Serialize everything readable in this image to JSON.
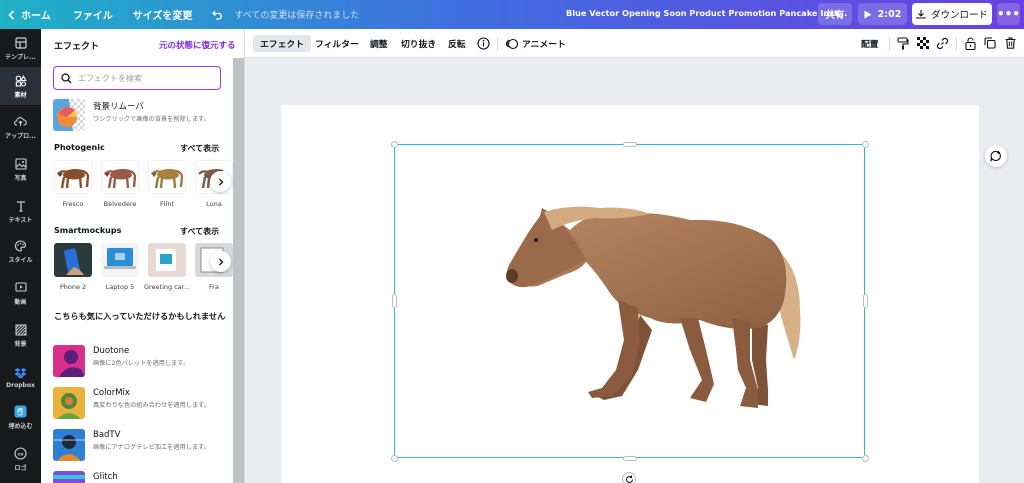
{
  "topbar": {
    "home": "ホーム",
    "file": "ファイル",
    "resize": "サイズを変更",
    "saved": "すべての変更は保存されました",
    "title": "Blue Vector Opening Soon Product Promotion Pancake Inst...",
    "share": "共有",
    "play": "2:02",
    "download": "ダウンロード",
    "more": "•••"
  },
  "rail": [
    {
      "label": "テンプレ...",
      "icon": "template-icon"
    },
    {
      "label": "素材",
      "icon": "elements-icon"
    },
    {
      "label": "アップロ...",
      "icon": "upload-icon"
    },
    {
      "label": "写真",
      "icon": "photo-icon"
    },
    {
      "label": "テキスト",
      "icon": "text-icon"
    },
    {
      "label": "スタイル",
      "icon": "style-icon"
    },
    {
      "label": "動画",
      "icon": "video-icon"
    },
    {
      "label": "背景",
      "icon": "background-icon"
    },
    {
      "label": "Dropbox",
      "icon": "dropbox-icon"
    },
    {
      "label": "埋め込む",
      "icon": "embed-icon"
    },
    {
      "label": "ロゴ",
      "icon": "logo-icon"
    }
  ],
  "panel": {
    "title": "エフェクト",
    "reset": "元の状態に復元する",
    "search_placeholder": "エフェクトを検索",
    "bg_remover": {
      "title": "背景リムーバ",
      "desc": "ワンクリックで画像の背景を削除します。"
    },
    "photogenic": {
      "heading": "Photogenic",
      "see_all": "すべて表示",
      "items": [
        "Fresco",
        "Belvedere",
        "Flint",
        "Luna"
      ]
    },
    "smartmockups": {
      "heading": "Smartmockups",
      "see_all": "すべて表示",
      "items": [
        "Phone 2",
        "Laptop 5",
        "Greeting car...",
        "Fra"
      ]
    },
    "recommend_heading": "こちらも気に入っていただけるかもしれません",
    "recommend": [
      {
        "title": "Duotone",
        "desc": "画像に2色パレットを適用します。"
      },
      {
        "title": "ColorMix",
        "desc": "風変わりな色の組み合わせを適用します。"
      },
      {
        "title": "BadTV",
        "desc": "画像にアナログテレビ加工を適用します。"
      },
      {
        "title": "Glitch",
        "desc": ""
      }
    ]
  },
  "toolbar": {
    "effects": "エフェクト",
    "filter": "フィルター",
    "adjust": "調整",
    "crop": "切り抜き",
    "flip": "反転",
    "animate": "アニメート",
    "position": "配置"
  },
  "colors": {
    "accent": "#8b3dff",
    "selection": "#2fbbd5",
    "rail_bg": "#18191b"
  }
}
